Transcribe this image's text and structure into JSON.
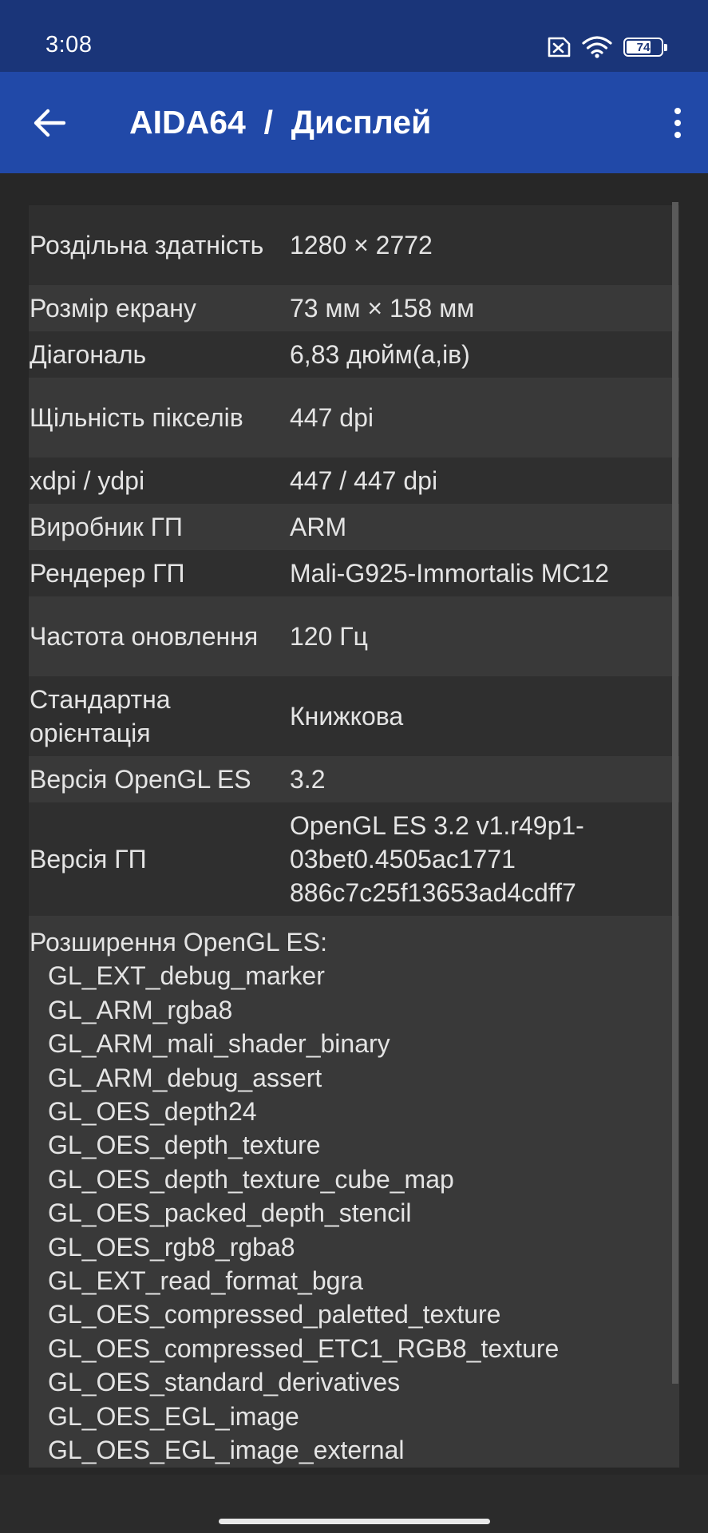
{
  "status_bar": {
    "time": "3:08",
    "icons": [
      "sim-off-icon",
      "wifi-icon",
      "battery-icon"
    ],
    "battery_level": "74",
    "battery_fraction": 0.74
  },
  "app_bar": {
    "back_icon": "arrow-left-icon",
    "title": "AIDA64  /  Дисплей",
    "menu_icon": "more-vert-icon"
  },
  "rows": [
    {
      "label": "Роздільна здатність",
      "value": "1280 × 2772"
    },
    {
      "label": "Розмір екрану",
      "value": "73 мм × 158 мм"
    },
    {
      "label": "Діагональ",
      "value": "6,83 дюйм(а,ів)"
    },
    {
      "label": "Щільність пікселів",
      "value": "447 dpi"
    },
    {
      "label": "xdpi / ydpi",
      "value": "447 / 447 dpi"
    },
    {
      "label": "Виробник ГП",
      "value": "ARM"
    },
    {
      "label": "Рендерер ГП",
      "value": "Mali-G925-Immortalis MC12"
    },
    {
      "label": "Частота оновлення",
      "value": "120 Гц"
    },
    {
      "label": "Стандартна орієнтація",
      "value": "Книжкова"
    },
    {
      "label": "Версія OpenGL ES",
      "value": "3.2"
    },
    {
      "label": "Версія ГП",
      "value": "OpenGL ES 3.2 v1.r49p1-03bet0.4505ac1771 886c7c25f13653ad4cdff7"
    }
  ],
  "extensions": {
    "header": "Розширення OpenGL ES:",
    "items": [
      "GL_EXT_debug_marker",
      "GL_ARM_rgba8",
      "GL_ARM_mali_shader_binary",
      "GL_ARM_debug_assert",
      "GL_OES_depth24",
      "GL_OES_depth_texture",
      "GL_OES_depth_texture_cube_map",
      "GL_OES_packed_depth_stencil",
      "GL_OES_rgb8_rgba8",
      "GL_EXT_read_format_bgra",
      "GL_OES_compressed_paletted_texture",
      "GL_OES_compressed_ETC1_RGB8_texture",
      "GL_OES_standard_derivatives",
      "GL_OES_EGL_image",
      "GL_OES_EGL_image_external"
    ]
  },
  "colors": {
    "status_bar": "#1a3579",
    "app_bar": "#2149a8",
    "background": "#272727",
    "row_odd": "#2f2f2f",
    "row_even": "#393939",
    "text": "#e4e4e4"
  }
}
